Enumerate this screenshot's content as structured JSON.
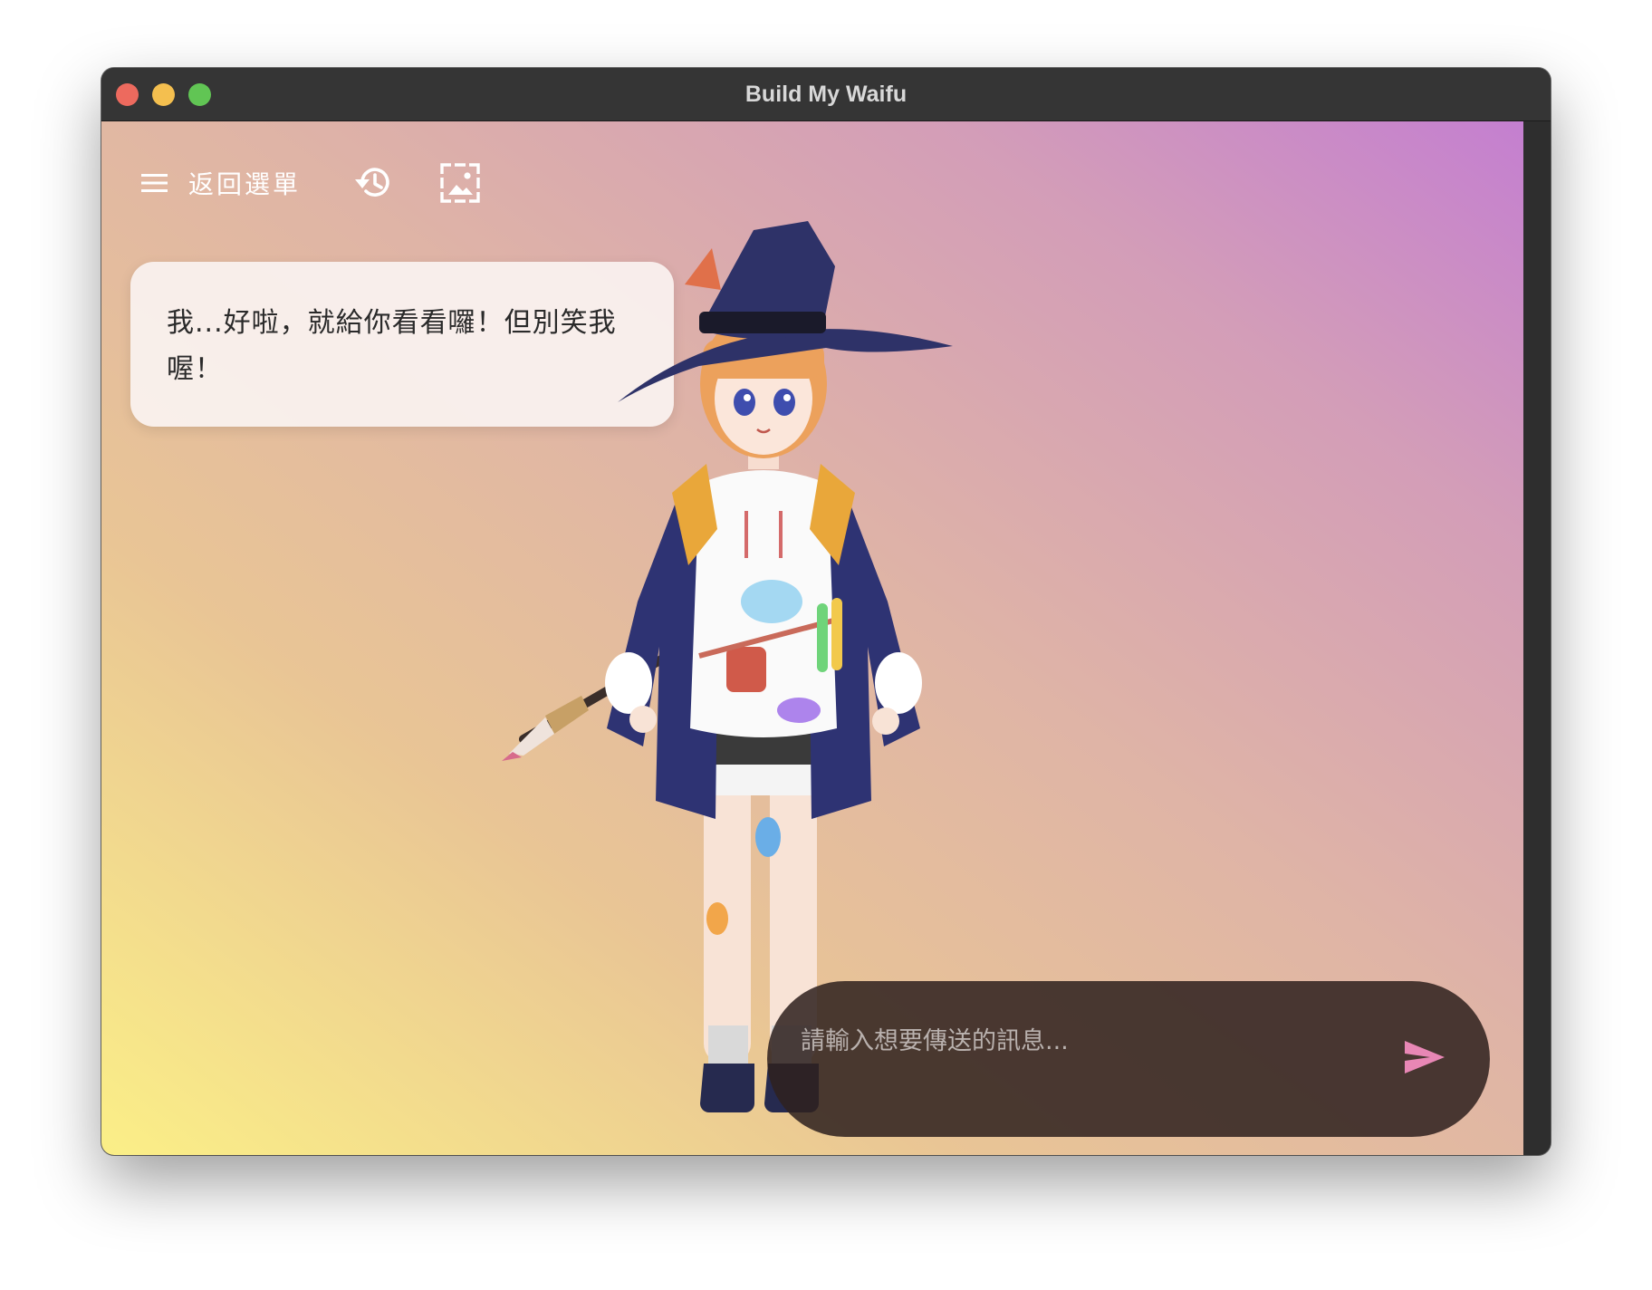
{
  "window": {
    "title": "Build My Waifu"
  },
  "toolbar": {
    "menu_label": "返回選單",
    "icons": {
      "menu": "menu-icon",
      "history": "history-icon",
      "image": "image-icon"
    }
  },
  "dialog": {
    "message": "我...好啦，就給你看看囉！但別笑我喔！"
  },
  "chat": {
    "input_value": "",
    "placeholder": "請輸入想要傳送的訊息...",
    "send_icon": "send-icon"
  },
  "colors": {
    "send_accent": "#e887b5",
    "gradient_start": "#fbef87",
    "gradient_end": "#c47fd0"
  }
}
